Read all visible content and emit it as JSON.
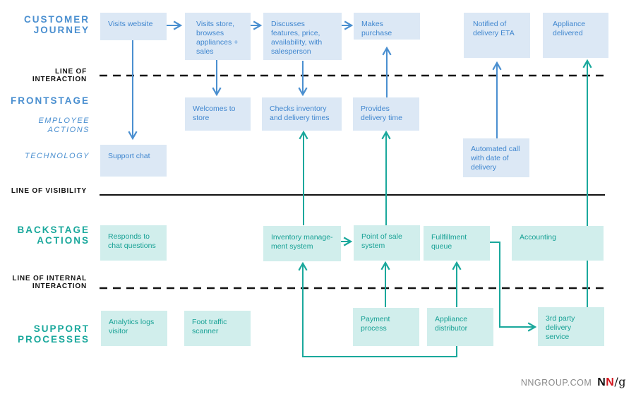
{
  "lanes": {
    "customer_journey": "CUSTOMER JOURNEY",
    "frontstage": "FRONTSTAGE",
    "employee_actions": "EMPLOYEE ACTIONS",
    "technology": "TECHNOLOGY",
    "backstage_actions": "BACKSTAGE ACTIONS",
    "support_processes": "SUPPORT PROCESSES"
  },
  "lines": {
    "interaction": "LINE OF INTERACTION",
    "visibility": "LINE OF VISIBILITY",
    "internal_interaction": "LINE OF INTERNAL INTERACTION"
  },
  "customer_journey": [
    "Visits website",
    "Visits store, browses appliances + sales",
    "Discusses features, price, availability, with salesperson",
    "Makes purchase",
    "Notified of delivery ETA",
    "Appliance delivered"
  ],
  "employee_actions": [
    "Welcomes to store",
    "Checks inventory and delivery times",
    "Provides delivery time"
  ],
  "technology": [
    "Support chat",
    "Automated call with date of delivery"
  ],
  "backstage_actions": [
    "Responds to chat questions",
    "Inventory manage-ment system",
    "Point of sale system",
    "Fullfillment queue",
    "Accounting"
  ],
  "support_processes": [
    "Analytics logs visitor",
    "Foot traffic scanner",
    "Payment process",
    "Appliance distributor",
    "3rd party delivery service"
  ],
  "footer": {
    "site": "NNGROUP.COM",
    "logo_n1": "N",
    "logo_n2": "N",
    "logo_g": "/g"
  },
  "colors": {
    "frontstage_blue": "#4a8fd0",
    "backstage_teal": "#1aa89c",
    "frontstage_box": "#dce8f5",
    "backstage_box": "#d1eeec",
    "logo_red": "#d4161f"
  }
}
